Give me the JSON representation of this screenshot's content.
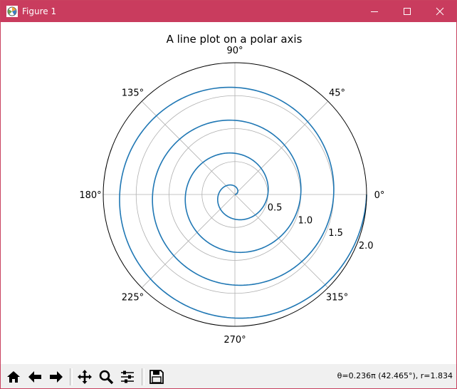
{
  "window": {
    "title": "Figure 1"
  },
  "chart_data": {
    "type": "line",
    "projection": "polar",
    "title": "A line plot on a polar axis",
    "r": [
      0,
      0.1,
      0.2,
      0.3,
      0.4,
      0.5,
      0.6,
      0.7,
      0.8,
      0.9,
      1.0,
      1.1,
      1.2,
      1.3,
      1.4,
      1.5,
      1.6,
      1.7,
      1.8,
      1.9,
      2.0
    ],
    "theta_deg": [
      0,
      72,
      144,
      216,
      288,
      360,
      432,
      504,
      576,
      648,
      720,
      792,
      864,
      936,
      1008,
      1080,
      1152,
      1224,
      1296,
      1368,
      1440
    ],
    "rmax": 2.0,
    "rticks": [
      "0.5",
      "1.0",
      "1.5",
      "2.0"
    ],
    "rtick_values": [
      0.5,
      1.0,
      1.5,
      2.0
    ],
    "theta_ticks": [
      "0°",
      "45°",
      "90°",
      "135°",
      "180°",
      "225°",
      "270°",
      "315°"
    ],
    "theta_tick_values": [
      0,
      45,
      90,
      135,
      180,
      225,
      270,
      315
    ],
    "rlabel_position_deg": -22.5,
    "grid": true,
    "line_color": "#1f77b4"
  },
  "status": {
    "coords": "θ=0.236π (42.465°), r=1.834"
  },
  "toolbar": {
    "buttons": [
      "home-icon",
      "back-arrow-icon",
      "forward-arrow-icon",
      "pan-icon",
      "zoom-icon",
      "configure-subplots-icon",
      "save-icon"
    ]
  },
  "colors": {
    "titlebar": "#c93c5e",
    "toolbar": "#f0f0f0"
  }
}
